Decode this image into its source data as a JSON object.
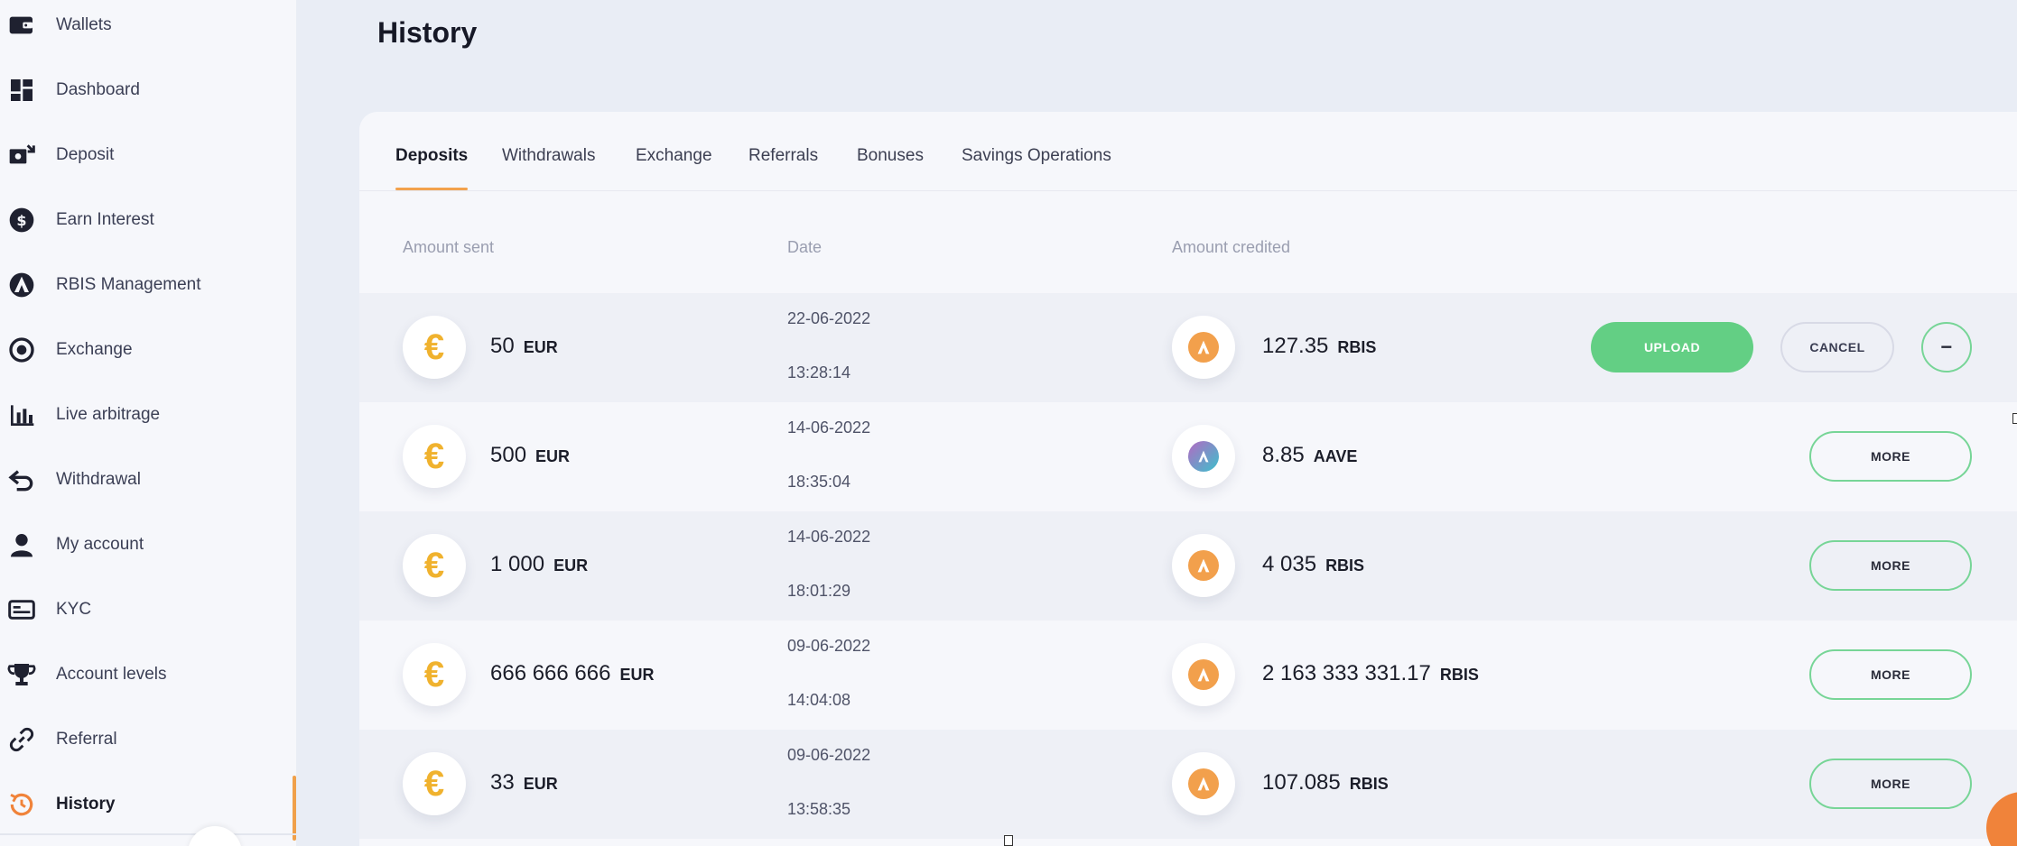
{
  "sidebar": {
    "items": [
      {
        "label": "Wallets",
        "icon": "wallet-icon"
      },
      {
        "label": "Dashboard",
        "icon": "dashboard-icon"
      },
      {
        "label": "Deposit",
        "icon": "deposit-icon"
      },
      {
        "label": "Earn Interest",
        "icon": "earn-interest-icon"
      },
      {
        "label": "RBIS Management",
        "icon": "rbis-icon"
      },
      {
        "label": "Exchange",
        "icon": "exchange-icon"
      },
      {
        "label": "Live arbitrage",
        "icon": "bar-chart-icon"
      },
      {
        "label": "Withdrawal",
        "icon": "withdrawal-icon"
      },
      {
        "label": "My account",
        "icon": "user-icon"
      },
      {
        "label": "KYC",
        "icon": "id-card-icon"
      },
      {
        "label": "Account levels",
        "icon": "trophy-icon"
      },
      {
        "label": "Referral",
        "icon": "link-icon"
      },
      {
        "label": "History",
        "icon": "history-icon",
        "active": true
      }
    ]
  },
  "page": {
    "title": "History"
  },
  "tabs": [
    {
      "label": "Deposits",
      "active": true
    },
    {
      "label": "Withdrawals"
    },
    {
      "label": "Exchange"
    },
    {
      "label": "Referrals"
    },
    {
      "label": "Bonuses"
    },
    {
      "label": "Savings Operations"
    }
  ],
  "table": {
    "headers": {
      "sent": "Amount sent",
      "date": "Date",
      "credited": "Amount credited"
    },
    "rows": [
      {
        "sent": "50",
        "sent_currency": "EUR",
        "date": "22-06-2022",
        "time": "13:28:14",
        "credited": "127.35",
        "credited_currency": "RBIS",
        "credited_coin": "rbis",
        "actions": [
          "UPLOAD",
          "CANCEL",
          "..."
        ]
      },
      {
        "sent": "500",
        "sent_currency": "EUR",
        "date": "14-06-2022",
        "time": "18:35:04",
        "credited": "8.85",
        "credited_currency": "AAVE",
        "credited_coin": "aave",
        "actions": [
          "MORE"
        ]
      },
      {
        "sent": "1 000",
        "sent_currency": "EUR",
        "date": "14-06-2022",
        "time": "18:01:29",
        "credited": "4 035",
        "credited_currency": "RBIS",
        "credited_coin": "rbis",
        "actions": [
          "MORE"
        ]
      },
      {
        "sent": "666 666 666",
        "sent_currency": "EUR",
        "date": "09-06-2022",
        "time": "14:04:08",
        "credited": "2 163 333 331.17",
        "credited_currency": "RBIS",
        "credited_coin": "rbis",
        "actions": [
          "MORE"
        ]
      },
      {
        "sent": "33",
        "sent_currency": "EUR",
        "date": "09-06-2022",
        "time": "13:58:35",
        "credited": "107.085",
        "credited_currency": "RBIS",
        "credited_coin": "rbis",
        "actions": [
          "MORE"
        ]
      }
    ]
  },
  "colors": {
    "accent": "#f2a14d",
    "success": "#63cf84",
    "eur": "#f0b22e"
  }
}
